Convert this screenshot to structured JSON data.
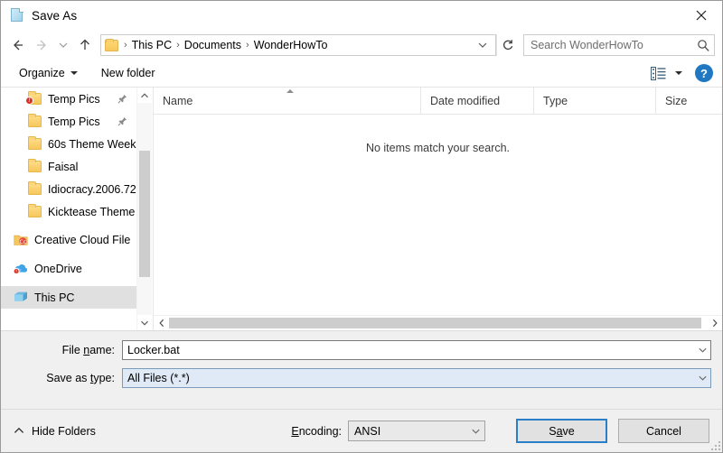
{
  "window": {
    "title": "Save As",
    "icon": "document-icon",
    "close_label": "✕"
  },
  "nav": {
    "back_label": "←",
    "forward_label": "→",
    "history_label": "∨",
    "up_label": "↑",
    "refresh_label": "↻",
    "breadcrumb": [
      "This PC",
      "Documents",
      "WonderHowTo"
    ],
    "breadcrumb_separator": "›",
    "address_chevron": "∨"
  },
  "search": {
    "placeholder": "Search WonderHowTo",
    "value": "",
    "icon": "search-icon"
  },
  "commandbar": {
    "organize_label": "Organize",
    "new_folder_label": "New folder",
    "view_icon": "view-list-icon",
    "view_caret": "▾",
    "help_label": "?"
  },
  "sidebar": {
    "items": [
      {
        "label": "Temp Pics",
        "icon": "folder-error-icon",
        "indent": 1,
        "pinned": true,
        "selected": false
      },
      {
        "label": "Temp Pics",
        "icon": "folder-icon",
        "indent": 1,
        "pinned": true,
        "selected": false
      },
      {
        "label": "60s Theme Week",
        "icon": "folder-icon",
        "indent": 1,
        "pinned": false,
        "selected": false
      },
      {
        "label": "Faisal",
        "icon": "folder-icon",
        "indent": 1,
        "pinned": false,
        "selected": false
      },
      {
        "label": "Idiocracy.2006.72",
        "icon": "folder-icon",
        "indent": 1,
        "pinned": false,
        "selected": false
      },
      {
        "label": "Kicktease Theme",
        "icon": "folder-icon",
        "indent": 1,
        "pinned": false,
        "selected": false
      },
      {
        "label": "Creative Cloud File",
        "icon": "creative-cloud-icon",
        "indent": 0,
        "pinned": false,
        "selected": false
      },
      {
        "label": "OneDrive",
        "icon": "onedrive-error-icon",
        "indent": 0,
        "pinned": false,
        "selected": false
      },
      {
        "label": "This PC",
        "icon": "this-pc-icon",
        "indent": 0,
        "pinned": false,
        "selected": true
      }
    ],
    "scroll_up": "∧",
    "scroll_down": "∨"
  },
  "filelist": {
    "columns": [
      "Name",
      "Date modified",
      "Type",
      "Size"
    ],
    "rows": [],
    "empty_message": "No items match your search.",
    "sort_indicator": "ascending",
    "hscroll_left": "‹",
    "hscroll_right": "›"
  },
  "form": {
    "filename": {
      "label_before": "File ",
      "label_accel": "n",
      "label_after": "ame:",
      "value": "Locker.bat",
      "arrow": "∨"
    },
    "filetype": {
      "label_before": "Save as ",
      "label_accel": "t",
      "label_after": "ype:",
      "value": "All Files  (*.*)",
      "arrow": "∨"
    }
  },
  "footer": {
    "hide_folders_label": "Hide Folders",
    "hide_folders_caret": "∧",
    "encoding_label_accel": "E",
    "encoding_label_rest": "ncoding:",
    "encoding_value": "ANSI",
    "encoding_arrow": "∨",
    "save_before": "S",
    "save_accel": "a",
    "save_after": "ve",
    "cancel_label": "Cancel"
  },
  "colors": {
    "accent": "#1f78c1",
    "focus_border": "#2a7fc9",
    "selection": "#e0e0e0",
    "tinted_field": "#dfeaf6",
    "dialog_bg": "#f0f0f0",
    "error_badge": "#d93025"
  }
}
